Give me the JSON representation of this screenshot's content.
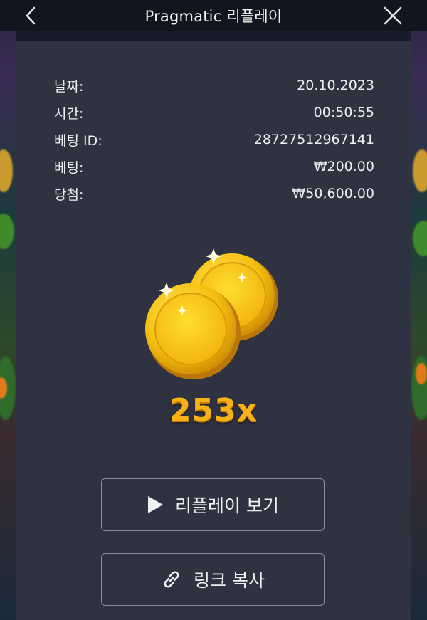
{
  "header": {
    "title": "Pragmatic 리플레이"
  },
  "info": {
    "rows": [
      {
        "label": "날짜:",
        "value": "20.10.2023"
      },
      {
        "label": "시간:",
        "value": "00:50:55"
      },
      {
        "label": "베팅 ID:",
        "value": "28727512967141"
      },
      {
        "label": "베팅:",
        "value": "₩200.00"
      },
      {
        "label": "당첨:",
        "value": "₩50,600.00"
      }
    ]
  },
  "result": {
    "multiplier": "253x"
  },
  "buttons": {
    "replay_label": "리플레이 보기",
    "copy_label": "링크 복사"
  },
  "icons": {
    "back": "chevron-left-icon",
    "close": "close-icon",
    "play": "play-icon",
    "link": "link-icon",
    "coins": "gold-coins-icon"
  },
  "colors": {
    "header_bg": "#12151f",
    "panel_bg": "#2f3240",
    "multiplier": "#f7b21a",
    "button_border": "#8e919c"
  }
}
